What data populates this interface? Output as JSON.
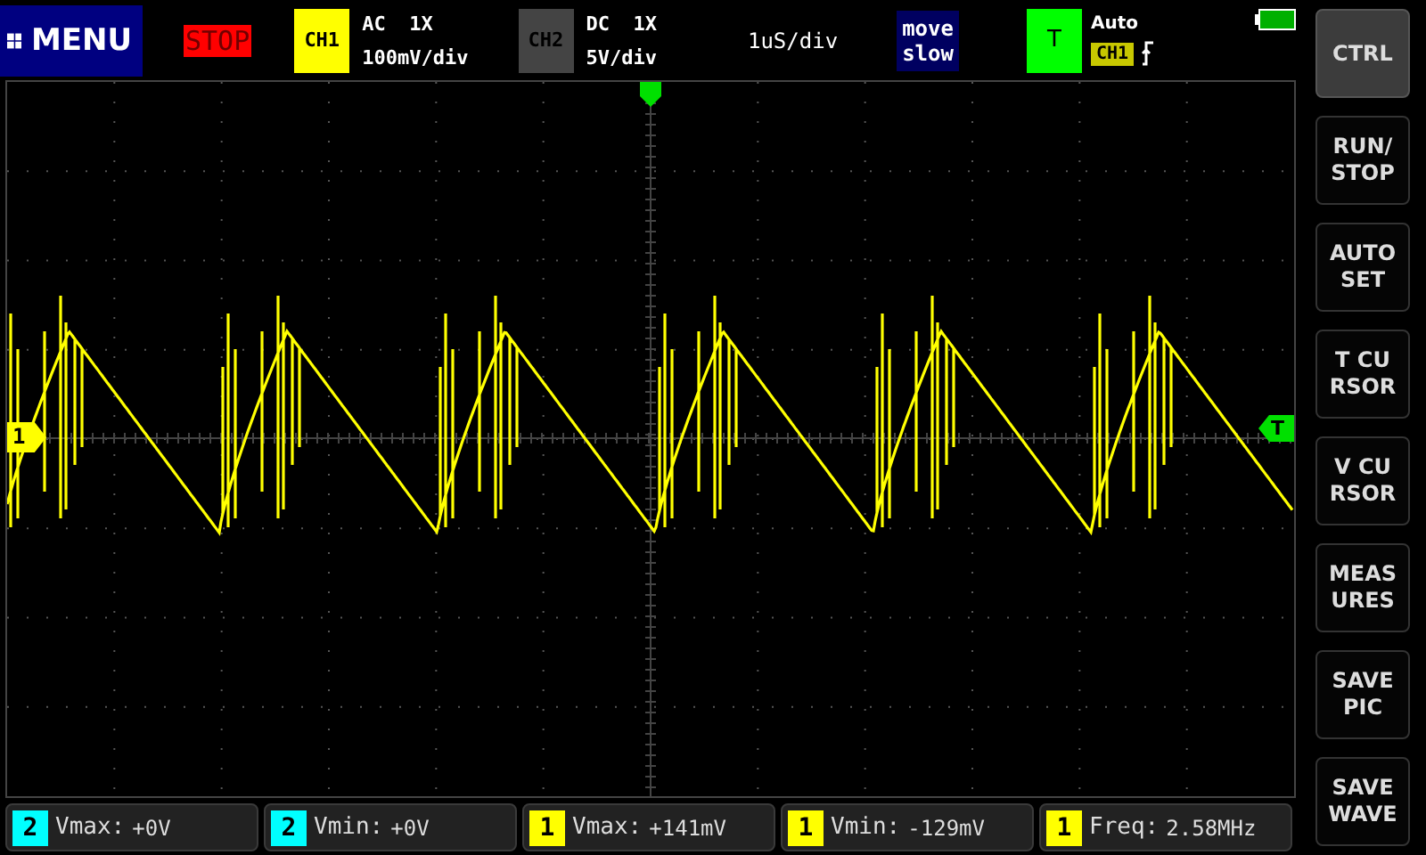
{
  "menu": {
    "label": "MENU"
  },
  "run_state": {
    "label": "STOP",
    "running": false
  },
  "channels": [
    {
      "label": "CH1",
      "on": true,
      "coupling": "AC",
      "probe": "1X",
      "scale": "100mV/div"
    },
    {
      "label": "CH2",
      "on": false,
      "coupling": "DC",
      "probe": "1X",
      "scale": "5V/div"
    }
  ],
  "timebase": "1uS/div",
  "move_mode": {
    "lines": [
      "move",
      "slow"
    ]
  },
  "trigger": {
    "label": "T",
    "mode": "Auto",
    "source": "CH1"
  },
  "markers": {
    "channel": "1",
    "trigger": "T"
  },
  "side_buttons": [
    {
      "lines": [
        "CTRL"
      ],
      "selected": true
    },
    {
      "lines": [
        "RUN/",
        "STOP"
      ],
      "selected": false
    },
    {
      "lines": [
        "AUTO",
        "SET"
      ],
      "selected": false
    },
    {
      "lines": [
        "T CU",
        "RSOR"
      ],
      "selected": false
    },
    {
      "lines": [
        "V CU",
        "RSOR"
      ],
      "selected": false
    },
    {
      "lines": [
        "MEAS",
        "URES"
      ],
      "selected": false
    },
    {
      "lines": [
        "SAVE",
        "PIC"
      ],
      "selected": false
    },
    {
      "lines": [
        "SAVE",
        "WAVE"
      ],
      "selected": false
    }
  ],
  "measurements": [
    {
      "channel": "2",
      "label": "Vmax:",
      "value": "+0V",
      "color": "#00ffff"
    },
    {
      "channel": "2",
      "label": "Vmin:",
      "value": "+0V",
      "color": "#00ffff"
    },
    {
      "channel": "1",
      "label": "Vmax:",
      "value": "+141mV",
      "color": "#ffff00"
    },
    {
      "channel": "1",
      "label": "Vmin:",
      "value": "-129mV",
      "color": "#ffff00"
    },
    {
      "channel": "1",
      "label": "Freq:",
      "value": "2.58MHz",
      "color": "#ffff00"
    }
  ]
}
